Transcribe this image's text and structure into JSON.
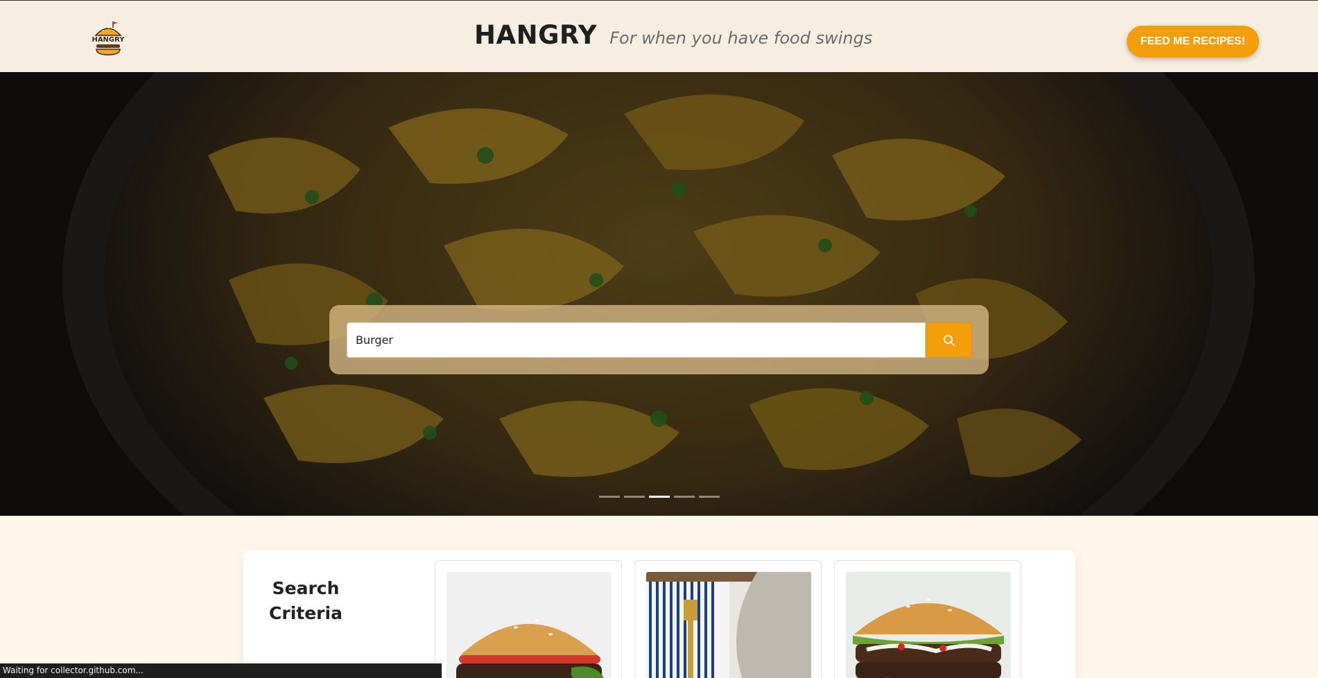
{
  "header": {
    "title": "HANGRY",
    "tagline": "For when you have food swings",
    "cta_label": "FEED ME RECIPES!",
    "logo_text": "HANGRY",
    "logo_icon": "burger-icon"
  },
  "search": {
    "value": "Burger",
    "button_icon": "search-icon"
  },
  "carousel": {
    "slides": 5,
    "active_index": 2
  },
  "results": {
    "criteria_title": "Search Criteria",
    "cards": [
      {
        "image": "burger-photo"
      },
      {
        "image": "fork-plate-photo"
      },
      {
        "image": "loaded-burger-photo"
      }
    ]
  },
  "status": {
    "text": "Waiting for collector.github.com..."
  },
  "colors": {
    "accent": "#f59e0b",
    "header_bg": "#f6efe1",
    "page_bg": "#fdf6e9"
  }
}
